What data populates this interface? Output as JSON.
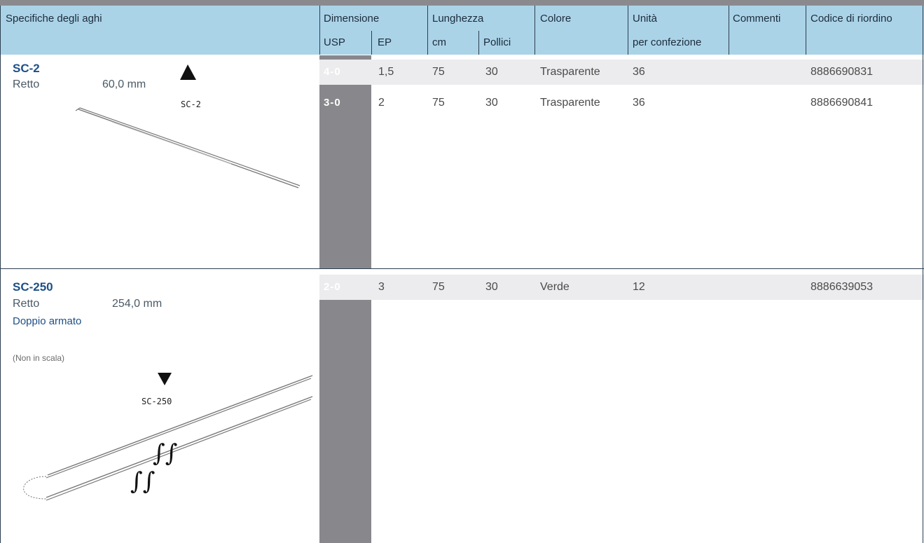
{
  "header": {
    "spec": "Specifiche degli aghi",
    "dimension": "Dimensione",
    "length": "Lunghezza",
    "color": "Colore",
    "unit": "Unità",
    "comments": "Commenti",
    "reorder": "Codice di riordino",
    "usp": "USP",
    "ep": "EP",
    "cm": "cm",
    "inches": "Pollici",
    "per_pack": "per confezione"
  },
  "products": [
    {
      "code": "SC-2",
      "shape": "Retto",
      "size": "60,0 mm",
      "needle_label": "SC-2",
      "rows": [
        {
          "usp": "4-0",
          "ep": "1,5",
          "cm": "75",
          "inches": "30",
          "color": "Trasparente",
          "units": "36",
          "comments": "",
          "reorder": "8886690831"
        },
        {
          "usp": "3-0",
          "ep": "2",
          "cm": "75",
          "inches": "30",
          "color": "Trasparente",
          "units": "36",
          "comments": "",
          "reorder": "8886690841"
        }
      ]
    },
    {
      "code": "SC-250",
      "shape": "Retto",
      "size": "254,0 mm",
      "armed": "Doppio armato",
      "scale_note": "(Non in scala)",
      "needle_label": "SC-250",
      "rows": [
        {
          "usp": "2-0",
          "ep": "3",
          "cm": "75",
          "inches": "30",
          "color": "Verde",
          "units": "12",
          "comments": "",
          "reorder": "8886639053"
        }
      ]
    }
  ],
  "colors": {
    "header_bg": "#abd3e8",
    "usp_col": "#88888c",
    "row_alt": "#ececee",
    "code_blue": "#1d4f86"
  }
}
